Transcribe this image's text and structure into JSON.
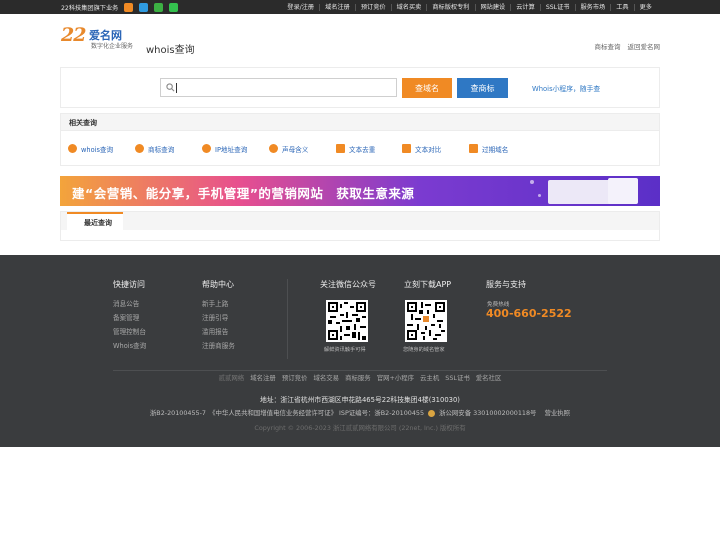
{
  "topbar": {
    "group_text": "22科技集团旗下业务",
    "links": [
      "登录/注册",
      "域名注册",
      "预订竞价",
      "域名买卖",
      "商标版权专利",
      "网站建设",
      "云计算",
      "SSL证书",
      "服务市场",
      "工具",
      "更多"
    ]
  },
  "header": {
    "logo_number": "22",
    "logo_cn": "爱名网",
    "logo_tagline": "数字化企业服务",
    "page_title": "whois查询",
    "links": [
      "商标查询",
      "返回爱名网"
    ]
  },
  "search": {
    "value": "",
    "domain_button": "查域名",
    "trademark_button": "查商标",
    "mini_program_link": "Whois小程序，随手查"
  },
  "related": {
    "title": "相关查询",
    "items": [
      "whois查询",
      "商标查询",
      "IP地址查询",
      "声母含义",
      "文本去重",
      "文本对比",
      "过期域名"
    ]
  },
  "banner": {
    "text": "建“会营销、能分享，手机管理”的营销网站　获取生意来源"
  },
  "recent": {
    "title": "最近查询"
  },
  "footer": {
    "quick_access": {
      "title": "快捷访问",
      "links": [
        "消息公告",
        "备案管理",
        "管理控制台",
        "Whois查询"
      ]
    },
    "help_center": {
      "title": "帮助中心",
      "links": [
        "新手上路",
        "注册引导",
        "滥用报告",
        "注册商服务"
      ]
    },
    "wechat": {
      "title": "关注微信公众号",
      "caption": "解鲜资讯触手可得"
    },
    "app": {
      "title": "立刻下载APP",
      "caption": "您随身的域名管家"
    },
    "support": {
      "title": "服务与支持",
      "hotline_label": "免费热线",
      "hotline": "400-660-2522"
    },
    "links": [
      "贰贰网络",
      "域名注册",
      "预订竞价",
      "域名交易",
      "商标服务",
      "官网+小程序",
      "云主机",
      "SSL证书",
      "爱名社区"
    ],
    "address": "地址：浙江省杭州市西湖区申花路465号22科技集团4楼(310030)",
    "icp": "浙B2-20100455-7　《中华人民共和国增值电信业务经营许可证》 ISP证编号：浙B2-20100455",
    "police": "浙公网安备 33010002000118号",
    "license": "营业执照",
    "copyright": "Copyright © 2006-2023 浙江贰贰网络有限公司 (22net, Inc.) 版权所有"
  },
  "colors": {
    "accent_orange": "#f08a24",
    "accent_blue": "#2f78c4",
    "footer_bg": "#3a3c3e",
    "hotline": "#f08a24"
  }
}
